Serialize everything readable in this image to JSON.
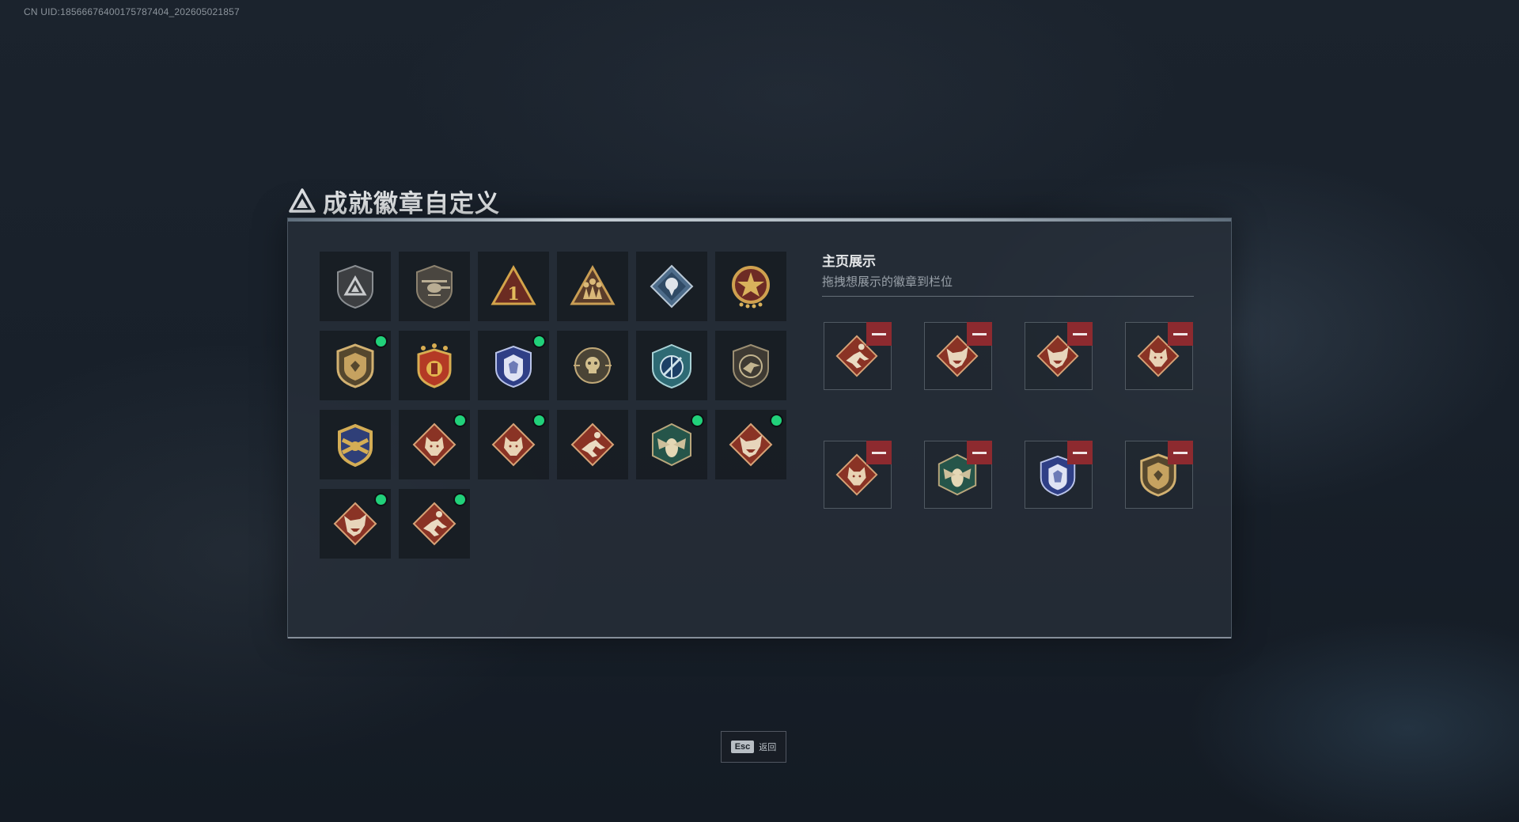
{
  "uid": "CN UID:1856667640017578740​4_202605021857",
  "title": "成就徽章自定义",
  "showcase": {
    "title": "主页展示",
    "subtitle": "拖拽想展示的徽章到栏位",
    "slots": [
      {
        "icon": "runner-badge-icon"
      },
      {
        "icon": "dragon-badge-icon"
      },
      {
        "icon": "dragon-badge-icon"
      },
      {
        "icon": "wolf-badge-icon"
      },
      {
        "icon": "wolf-badge-icon"
      },
      {
        "icon": "green-hornet-badge-icon"
      },
      {
        "icon": "blue-wolf-shield-badge-icon"
      },
      {
        "icon": "gold-shield-badge-icon"
      }
    ]
  },
  "badges": [
    {
      "icon": "triangle-shield-badge-icon",
      "equipped": false
    },
    {
      "icon": "helicopter-shield-badge-icon",
      "equipped": false
    },
    {
      "icon": "number-one-badge-icon",
      "equipped": false
    },
    {
      "icon": "soldiers-badge-icon",
      "equipped": false
    },
    {
      "icon": "silver-rose-badge-icon",
      "equipped": false
    },
    {
      "icon": "star-medal-badge-icon",
      "equipped": false
    },
    {
      "icon": "gold-shield-badge-icon",
      "equipped": true
    },
    {
      "icon": "stars-crest-badge-icon",
      "equipped": false
    },
    {
      "icon": "blue-wolf-shield-badge-icon",
      "equipped": true
    },
    {
      "icon": "skull-crosshair-badge-icon",
      "equipped": false
    },
    {
      "icon": "blue-crosshair-shield-badge-icon",
      "equipped": false
    },
    {
      "icon": "bird-shield-badge-icon",
      "equipped": false
    },
    {
      "icon": "eagle-crest-badge-icon",
      "equipped": false
    },
    {
      "icon": "wolf-badge-icon",
      "equipped": true
    },
    {
      "icon": "wolf-badge-icon",
      "equipped": true
    },
    {
      "icon": "runner-badge-icon",
      "equipped": false
    },
    {
      "icon": "green-hornet-badge-icon",
      "equipped": true
    },
    {
      "icon": "dragon-badge-icon",
      "equipped": true
    },
    {
      "icon": "dragon-badge-icon",
      "equipped": true
    },
    {
      "icon": "runner-badge-icon",
      "equipped": true
    }
  ],
  "esc": {
    "key": "Esc",
    "label": "返回"
  },
  "colors": {
    "equipped_dot": "#21d17a",
    "remove_button": "#8d2a2f"
  }
}
